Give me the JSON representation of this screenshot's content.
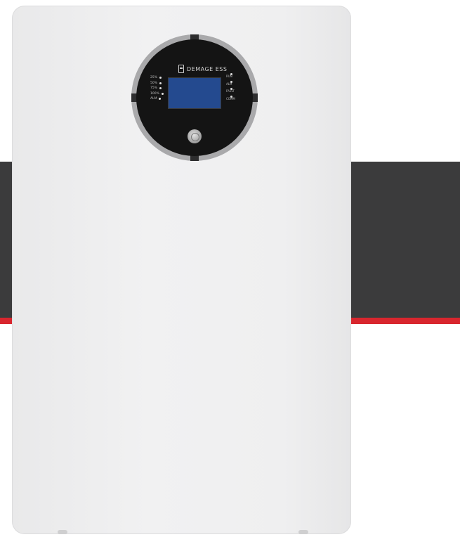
{
  "brand": {
    "name": "DEMAGE ESS"
  },
  "soc_indicators": [
    {
      "label": "25%"
    },
    {
      "label": "50%"
    },
    {
      "label": "75%"
    },
    {
      "label": "100%"
    },
    {
      "label": "ALM"
    }
  ],
  "status_indicators": [
    {
      "label": "RUN"
    },
    {
      "label": "ALM"
    },
    {
      "label": "FAULT"
    },
    {
      "label": "COMM"
    }
  ],
  "colors": {
    "cabinet": "#efeff0",
    "band_gray": "#3b3b3c",
    "band_red": "#d8262e",
    "lcd": "#244a8f"
  }
}
